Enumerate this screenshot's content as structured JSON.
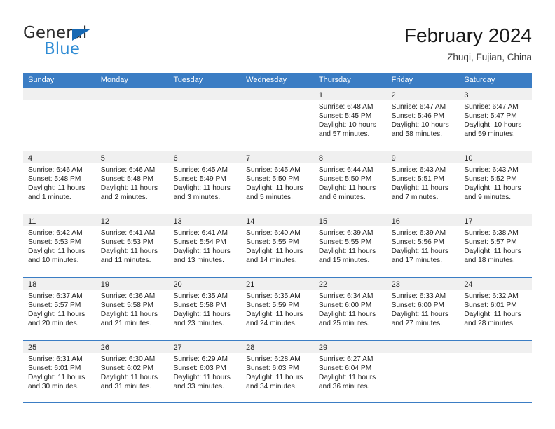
{
  "brand": {
    "name_top": "General",
    "name_bottom": "Blue",
    "triangle_color": "#1668b3",
    "blue_color": "#2e8bd4"
  },
  "header": {
    "title": "February 2024",
    "subtitle": "Zhuqi, Fujian, China"
  },
  "theme": {
    "header_blue": "#3b7dc4",
    "band_gray": "#f0f0f0"
  },
  "weekdays": [
    "Sunday",
    "Monday",
    "Tuesday",
    "Wednesday",
    "Thursday",
    "Friday",
    "Saturday"
  ],
  "weeks": [
    [
      {
        "day": "",
        "sunrise": "",
        "sunset": "",
        "daylight": ""
      },
      {
        "day": "",
        "sunrise": "",
        "sunset": "",
        "daylight": ""
      },
      {
        "day": "",
        "sunrise": "",
        "sunset": "",
        "daylight": ""
      },
      {
        "day": "",
        "sunrise": "",
        "sunset": "",
        "daylight": ""
      },
      {
        "day": "1",
        "sunrise": "Sunrise: 6:48 AM",
        "sunset": "Sunset: 5:45 PM",
        "daylight": "Daylight: 10 hours and 57 minutes."
      },
      {
        "day": "2",
        "sunrise": "Sunrise: 6:47 AM",
        "sunset": "Sunset: 5:46 PM",
        "daylight": "Daylight: 10 hours and 58 minutes."
      },
      {
        "day": "3",
        "sunrise": "Sunrise: 6:47 AM",
        "sunset": "Sunset: 5:47 PM",
        "daylight": "Daylight: 10 hours and 59 minutes."
      }
    ],
    [
      {
        "day": "4",
        "sunrise": "Sunrise: 6:46 AM",
        "sunset": "Sunset: 5:48 PM",
        "daylight": "Daylight: 11 hours and 1 minute."
      },
      {
        "day": "5",
        "sunrise": "Sunrise: 6:46 AM",
        "sunset": "Sunset: 5:48 PM",
        "daylight": "Daylight: 11 hours and 2 minutes."
      },
      {
        "day": "6",
        "sunrise": "Sunrise: 6:45 AM",
        "sunset": "Sunset: 5:49 PM",
        "daylight": "Daylight: 11 hours and 3 minutes."
      },
      {
        "day": "7",
        "sunrise": "Sunrise: 6:45 AM",
        "sunset": "Sunset: 5:50 PM",
        "daylight": "Daylight: 11 hours and 5 minutes."
      },
      {
        "day": "8",
        "sunrise": "Sunrise: 6:44 AM",
        "sunset": "Sunset: 5:50 PM",
        "daylight": "Daylight: 11 hours and 6 minutes."
      },
      {
        "day": "9",
        "sunrise": "Sunrise: 6:43 AM",
        "sunset": "Sunset: 5:51 PM",
        "daylight": "Daylight: 11 hours and 7 minutes."
      },
      {
        "day": "10",
        "sunrise": "Sunrise: 6:43 AM",
        "sunset": "Sunset: 5:52 PM",
        "daylight": "Daylight: 11 hours and 9 minutes."
      }
    ],
    [
      {
        "day": "11",
        "sunrise": "Sunrise: 6:42 AM",
        "sunset": "Sunset: 5:53 PM",
        "daylight": "Daylight: 11 hours and 10 minutes."
      },
      {
        "day": "12",
        "sunrise": "Sunrise: 6:41 AM",
        "sunset": "Sunset: 5:53 PM",
        "daylight": "Daylight: 11 hours and 11 minutes."
      },
      {
        "day": "13",
        "sunrise": "Sunrise: 6:41 AM",
        "sunset": "Sunset: 5:54 PM",
        "daylight": "Daylight: 11 hours and 13 minutes."
      },
      {
        "day": "14",
        "sunrise": "Sunrise: 6:40 AM",
        "sunset": "Sunset: 5:55 PM",
        "daylight": "Daylight: 11 hours and 14 minutes."
      },
      {
        "day": "15",
        "sunrise": "Sunrise: 6:39 AM",
        "sunset": "Sunset: 5:55 PM",
        "daylight": "Daylight: 11 hours and 15 minutes."
      },
      {
        "day": "16",
        "sunrise": "Sunrise: 6:39 AM",
        "sunset": "Sunset: 5:56 PM",
        "daylight": "Daylight: 11 hours and 17 minutes."
      },
      {
        "day": "17",
        "sunrise": "Sunrise: 6:38 AM",
        "sunset": "Sunset: 5:57 PM",
        "daylight": "Daylight: 11 hours and 18 minutes."
      }
    ],
    [
      {
        "day": "18",
        "sunrise": "Sunrise: 6:37 AM",
        "sunset": "Sunset: 5:57 PM",
        "daylight": "Daylight: 11 hours and 20 minutes."
      },
      {
        "day": "19",
        "sunrise": "Sunrise: 6:36 AM",
        "sunset": "Sunset: 5:58 PM",
        "daylight": "Daylight: 11 hours and 21 minutes."
      },
      {
        "day": "20",
        "sunrise": "Sunrise: 6:35 AM",
        "sunset": "Sunset: 5:58 PM",
        "daylight": "Daylight: 11 hours and 23 minutes."
      },
      {
        "day": "21",
        "sunrise": "Sunrise: 6:35 AM",
        "sunset": "Sunset: 5:59 PM",
        "daylight": "Daylight: 11 hours and 24 minutes."
      },
      {
        "day": "22",
        "sunrise": "Sunrise: 6:34 AM",
        "sunset": "Sunset: 6:00 PM",
        "daylight": "Daylight: 11 hours and 25 minutes."
      },
      {
        "day": "23",
        "sunrise": "Sunrise: 6:33 AM",
        "sunset": "Sunset: 6:00 PM",
        "daylight": "Daylight: 11 hours and 27 minutes."
      },
      {
        "day": "24",
        "sunrise": "Sunrise: 6:32 AM",
        "sunset": "Sunset: 6:01 PM",
        "daylight": "Daylight: 11 hours and 28 minutes."
      }
    ],
    [
      {
        "day": "25",
        "sunrise": "Sunrise: 6:31 AM",
        "sunset": "Sunset: 6:01 PM",
        "daylight": "Daylight: 11 hours and 30 minutes."
      },
      {
        "day": "26",
        "sunrise": "Sunrise: 6:30 AM",
        "sunset": "Sunset: 6:02 PM",
        "daylight": "Daylight: 11 hours and 31 minutes."
      },
      {
        "day": "27",
        "sunrise": "Sunrise: 6:29 AM",
        "sunset": "Sunset: 6:03 PM",
        "daylight": "Daylight: 11 hours and 33 minutes."
      },
      {
        "day": "28",
        "sunrise": "Sunrise: 6:28 AM",
        "sunset": "Sunset: 6:03 PM",
        "daylight": "Daylight: 11 hours and 34 minutes."
      },
      {
        "day": "29",
        "sunrise": "Sunrise: 6:27 AM",
        "sunset": "Sunset: 6:04 PM",
        "daylight": "Daylight: 11 hours and 36 minutes."
      },
      {
        "day": "",
        "sunrise": "",
        "sunset": "",
        "daylight": ""
      },
      {
        "day": "",
        "sunrise": "",
        "sunset": "",
        "daylight": ""
      }
    ]
  ]
}
